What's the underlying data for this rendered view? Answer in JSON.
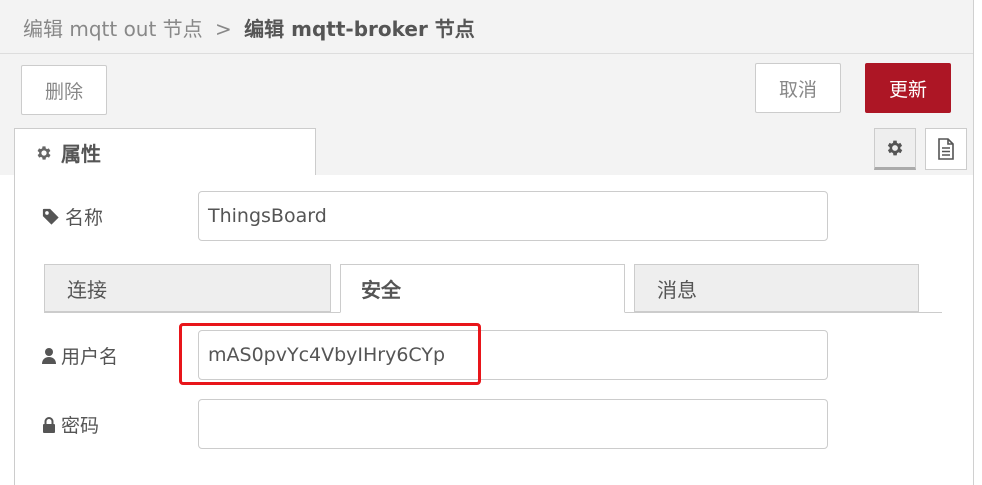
{
  "breadcrumb": {
    "parent": "编辑 mqtt out 节点",
    "separator": ">",
    "current": "编辑 mqtt-broker 节点"
  },
  "toolbar": {
    "delete_label": "删除",
    "cancel_label": "取消",
    "update_label": "更新"
  },
  "tabs": {
    "properties_label": "属性",
    "settings_icon": "gear-icon",
    "description_icon": "document-icon"
  },
  "fields": {
    "name": {
      "label": "名称",
      "icon": "tag-icon",
      "value": "ThingsBoard"
    },
    "username": {
      "label": "用户名",
      "icon": "user-icon",
      "value": "mAS0pvYc4VbyIHry6CYp"
    },
    "password": {
      "label": "密码",
      "icon": "lock-icon",
      "value": ""
    }
  },
  "subtabs": [
    {
      "label": "连接",
      "active": false
    },
    {
      "label": "安全",
      "active": true
    },
    {
      "label": "消息",
      "active": false
    }
  ],
  "colors": {
    "accent": "#ad1625",
    "highlight": "#e8151a"
  }
}
